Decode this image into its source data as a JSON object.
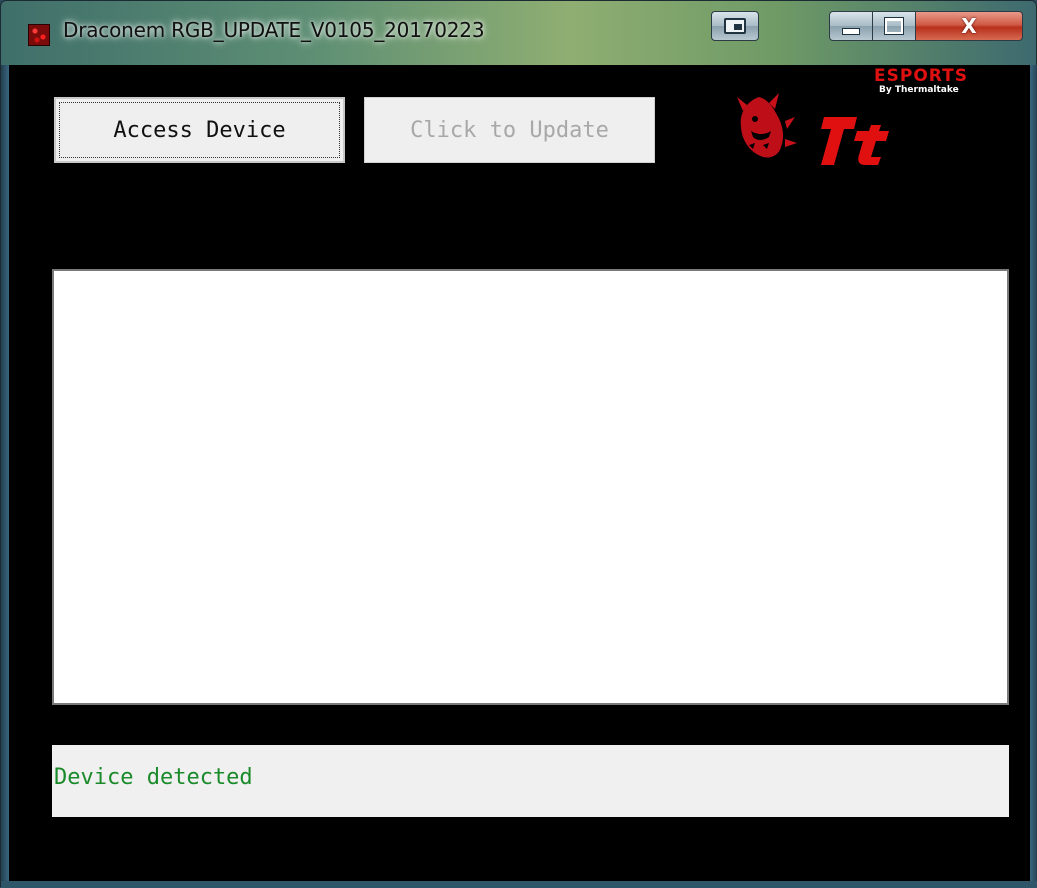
{
  "window": {
    "title": "Draconem RGB_UPDATE_V0105_20170223",
    "icon": "draconem-app-icon"
  },
  "caption_buttons": {
    "snap": "snap-window-icon",
    "minimize": "minimize-icon",
    "maximize": "maximize-icon",
    "close": "X"
  },
  "toolbar": {
    "access_label": "Access Device",
    "update_label": "Click to Update",
    "update_enabled": false
  },
  "brand": {
    "logo_main": "ESPORTS",
    "logo_sub": "By Thermaltake",
    "logo_mark": "Tt",
    "brand_color": "#e01010"
  },
  "log": {
    "content": ""
  },
  "status": {
    "text": "Device detected",
    "color": "#1a8a2a"
  }
}
